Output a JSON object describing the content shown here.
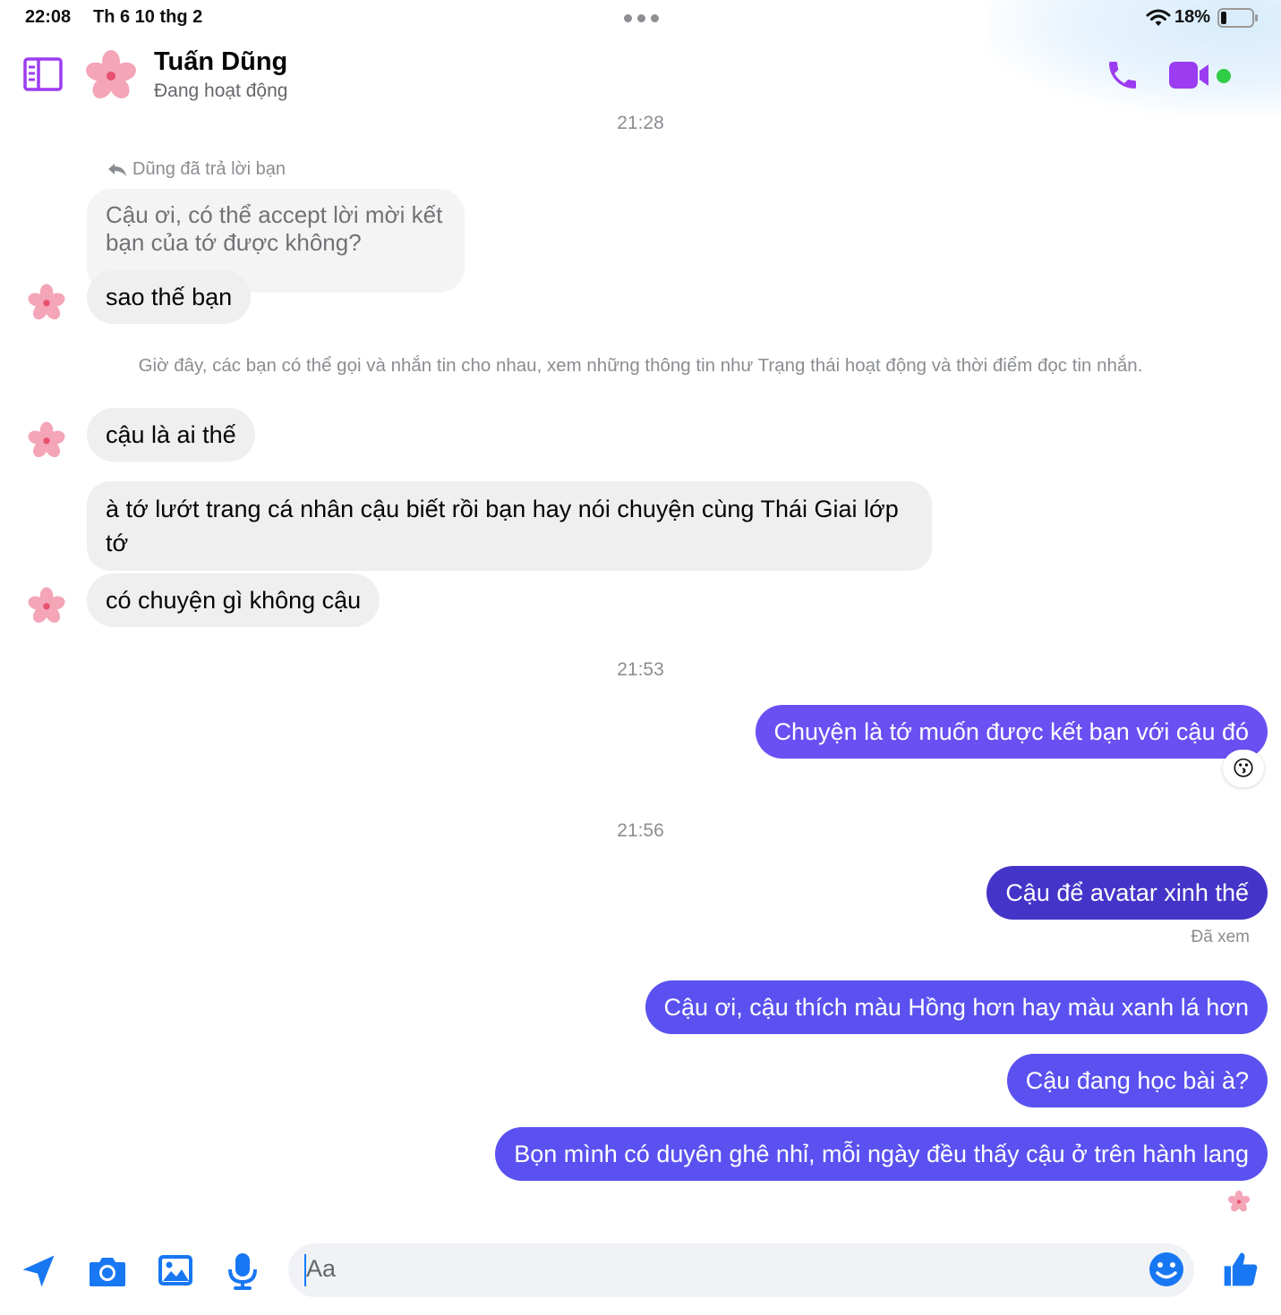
{
  "status_bar": {
    "time": "22:08",
    "date": "Th 6 10 thg 2",
    "battery": "18%",
    "battery_level_fraction": 0.18
  },
  "header": {
    "contact_name": "Tuấn Dũng",
    "contact_status": "Đang hoạt động",
    "icons": [
      "sidebar-toggle-icon",
      "flower-avatar",
      "phone-icon",
      "video-camera-icon",
      "online-dot"
    ]
  },
  "conversation": {
    "time_1": "21:28",
    "reply_label": "Dũng đã trả lời bạn",
    "quoted_message": "Cậu ơi, có thể accept lời mời kết bạn của tớ được không?",
    "incoming": [
      "sao thế bạn",
      "cậu là ai thế",
      "à tớ lướt trang cá nhân cậu biết rồi bạn hay nói chuyện cùng Thái Giai lớp tớ",
      "có chuyện gì không cậu"
    ],
    "notice": "Giờ đây, các bạn có thể gọi và nhắn tin cho nhau, xem những thông tin như Trạng thái hoạt động và thời điểm đọc tin nhắn.",
    "time_2": "21:53",
    "outgoing_1": "Chuyện là tớ muốn được kết bạn với cậu đó",
    "reaction": "😗",
    "time_3": "21:56",
    "outgoing_2": "Cậu để avatar xinh thế",
    "seen_label": "Đã xem",
    "outgoing_3": "Cậu ơi, cậu thích màu Hồng hơn hay màu xanh lá hơn",
    "outgoing_4": "Cậu đang học bài à?",
    "outgoing_5": "Bọn mình có duyên ghê nhỉ, mỗi ngày đều thấy cậu ở trên hành lang"
  },
  "composer": {
    "placeholder": "Aa",
    "icons": [
      "send-location-icon",
      "camera-icon",
      "gallery-icon",
      "microphone-icon",
      "emoji-icon",
      "like-icon"
    ]
  },
  "colors": {
    "accent": "#9c3cf0",
    "bubble_in": "#efefef",
    "bubble_out_light": "#5a51f0",
    "bubble_out_dark": "#4534c8",
    "online": "#31cc46",
    "composer_blue": "#1877f2"
  }
}
